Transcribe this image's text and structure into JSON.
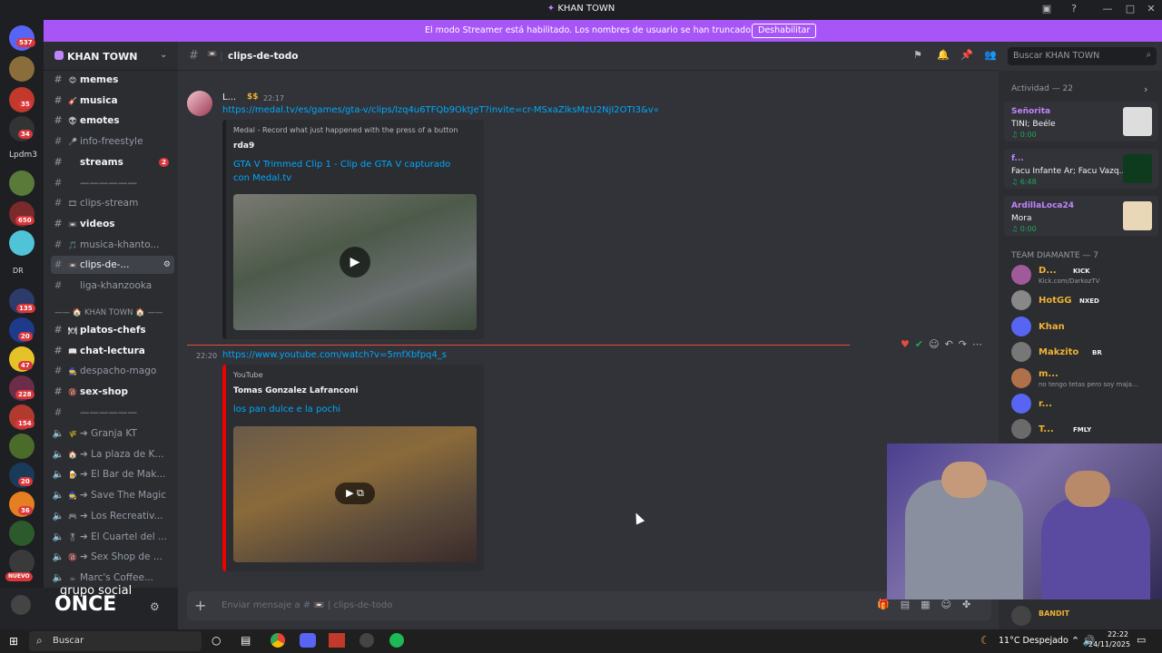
{
  "window": {
    "title": "KHAN TOWN"
  },
  "banner": {
    "message": "El modo Streamer está habilitado. Los nombres de usuario se han truncado.",
    "button": "Deshabilitar"
  },
  "servers": [
    {
      "badge": "537"
    },
    {
      "badge": ""
    },
    {
      "badge": "35"
    },
    {
      "badge": ""
    },
    {
      "badge": "34"
    },
    {
      "label": "Lpdm3"
    },
    {
      "badge": ""
    },
    {
      "badge": "650"
    },
    {
      "badge": ""
    },
    {
      "label": "DR"
    },
    {
      "badge": "135"
    },
    {
      "badge": "20"
    },
    {
      "badge": "47"
    },
    {
      "badge": "228"
    },
    {
      "badge": "154"
    },
    {
      "badge": ""
    },
    {
      "badge": "20"
    },
    {
      "badge": "36"
    },
    {
      "badge": ""
    },
    {
      "badge": "NUEVO"
    }
  ],
  "guild": {
    "name": "KHAN TOWN"
  },
  "channels": [
    {
      "name": "memes",
      "icon": "😊",
      "unread": true
    },
    {
      "name": "musica",
      "icon": "🎸",
      "unread": true
    },
    {
      "name": "emotes",
      "icon": "👽",
      "unread": true
    },
    {
      "name": "info-freestyle",
      "icon": "🎤",
      "unread": false
    },
    {
      "name": "streams",
      "icon": "",
      "unread": true,
      "badge": "2"
    },
    {
      "name": "——————",
      "icon": "",
      "unread": false
    },
    {
      "name": "clips-stream",
      "icon": "🎞",
      "unread": false
    },
    {
      "name": "videos",
      "icon": "📼",
      "unread": true
    },
    {
      "name": "musica-khanto...",
      "icon": "🎵",
      "unread": false
    },
    {
      "name": "clips-de-...",
      "icon": "📼",
      "unread": false,
      "active": true
    },
    {
      "name": "liga-khanzooka",
      "icon": "",
      "unread": false
    }
  ],
  "category": "—— 🏠 KHAN TOWN 🏠 ——",
  "channels2": [
    {
      "name": "platos-chefs",
      "icon": "🍽",
      "unread": true
    },
    {
      "name": "chat-lectura",
      "icon": "📖",
      "unread": true
    },
    {
      "name": "despacho-mago",
      "icon": "🧙",
      "unread": false
    },
    {
      "name": "sex-shop",
      "icon": "🔞",
      "unread": true
    },
    {
      "name": "——————",
      "icon": "",
      "unread": false
    }
  ],
  "voice": [
    {
      "name": "➔ Granja KT",
      "icon": "🌾"
    },
    {
      "name": "➔ La plaza de K...",
      "icon": "🏠"
    },
    {
      "name": "➔ El Bar de Mak...",
      "icon": "🍺"
    },
    {
      "name": "➔ Save The Magic",
      "icon": "🧙"
    },
    {
      "name": "➔ Los Recreativ...",
      "icon": "🎮"
    },
    {
      "name": "➔ El Cuartel del ...",
      "icon": "🎖"
    },
    {
      "name": "➔ Sex Shop de ...",
      "icon": "🔞"
    },
    {
      "name": "Marc's Coffee...",
      "icon": "☕"
    }
  ],
  "userbar": {
    "line1": "grupo social",
    "line2": "ONCE"
  },
  "chat": {
    "channel": "clips-de-todo",
    "search_placeholder": "Buscar KHAN TOWN",
    "msg1": {
      "author": "L...",
      "time": "22:17",
      "tag": "$$",
      "link": "https://medal.tv/es/games/gta-v/clips/lzq4u6TFQb9OktJeT?invite=cr-MSxaZlksMzU2NjI2OTI3&v=23",
      "embed": {
        "provider": "Medal - Record what just happened with the press of a button",
        "author": "rda9",
        "title": "GTA V Trimmed Clip 1 - Clip de GTA V capturado con Medal.tv"
      }
    },
    "msg2": {
      "time": "22:20",
      "link": "https://www.youtube.com/watch?v=5mfXbfpq4_s",
      "embed": {
        "provider": "YouTube",
        "author": "Tomas Gonzalez Lafranconi",
        "title": "los pan dulce e la pochi"
      }
    },
    "composer_placeholder": "Enviar mensaje a # 📼 | clips-de-todo"
  },
  "members": {
    "activity_header": "Actividad — 22",
    "activity": [
      {
        "name": "Señorita",
        "detail": "TINI; Beéle",
        "time": "0:00"
      },
      {
        "name": "f...",
        "detail": "Facu Infante Ar; Facu Vazq...",
        "time": "6:48"
      },
      {
        "name": "ArdillaLoca24",
        "detail": "Mora",
        "time": "0:00"
      }
    ],
    "team_header": "TEAM DIAMANTE — 7",
    "team": [
      {
        "name": "D...",
        "tag": "KICK",
        "sub": "Kick.com/DarkozTV"
      },
      {
        "name": "HotGG",
        "tag": "NXED",
        "sub": ""
      },
      {
        "name": "Khan",
        "tag": "",
        "sub": ""
      },
      {
        "name": "Makzito",
        "tag": "BR",
        "sub": ""
      },
      {
        "name": "m...",
        "tag": "",
        "sub": "no tengo tetas pero soy maja..."
      },
      {
        "name": "r...",
        "tag": "",
        "sub": ""
      },
      {
        "name": "T...",
        "tag": "FMLY",
        "sub": ""
      }
    ],
    "bottom": "BANDIT"
  },
  "taskbar": {
    "search": "Buscar",
    "weather": "11°C Despejado",
    "time": "22:22",
    "date": "24/11/2025"
  },
  "colors": {
    "accent": "#a855f7",
    "link": "#00a8fc",
    "badge": "#da373c",
    "online": "#23a55a"
  }
}
